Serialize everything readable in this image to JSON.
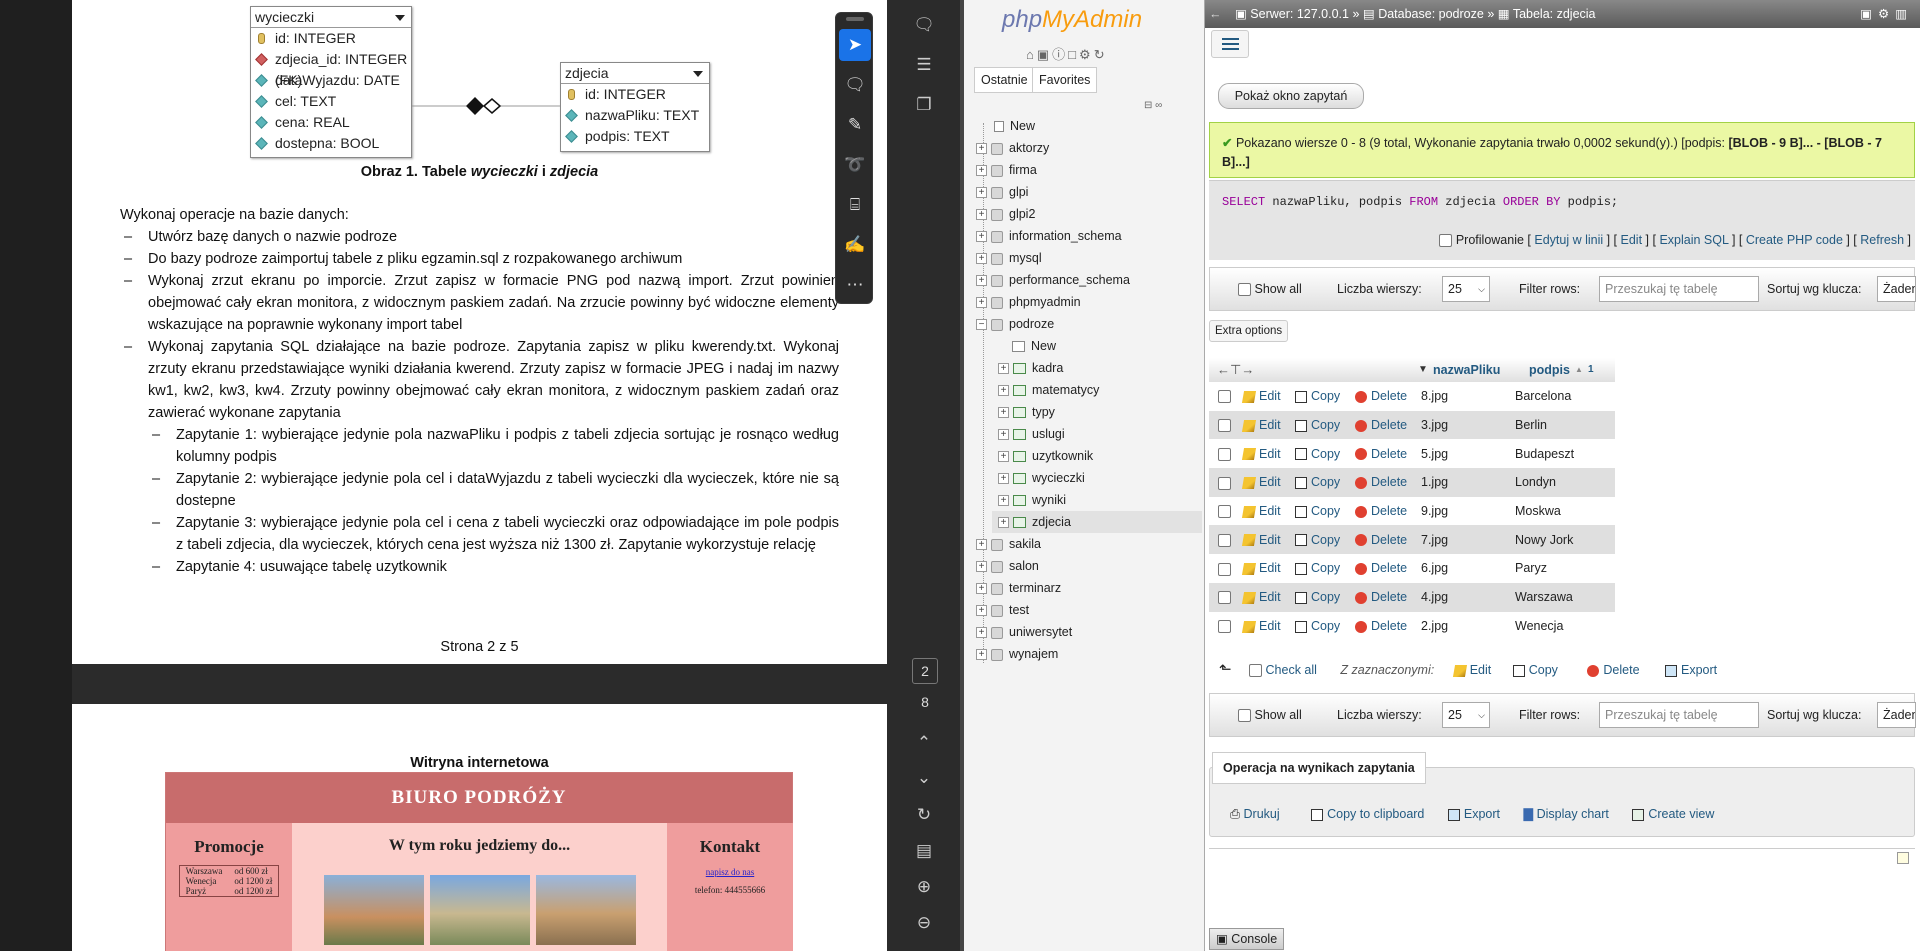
{
  "pdf": {
    "er": {
      "wycieczki": {
        "title": "wycieczki",
        "fields": [
          "id: INTEGER",
          "zdjecia_id: INTEGER (FK)",
          "dataWyjazdu: DATE",
          "cel: TEXT",
          "cena: REAL",
          "dostepna: BOOL"
        ]
      },
      "zdjecia": {
        "title": "zdjecia",
        "fields": [
          "id: INTEGER",
          "nazwaPliku: TEXT",
          "podpis: TEXT"
        ]
      }
    },
    "caption_prefix": "Obraz 1. Tabele ",
    "caption_t1": "wycieczki",
    "caption_mid": " i ",
    "caption_t2": "zdjecia",
    "intro": "Wykonaj operacje na bazie danych:",
    "items": [
      "Utwórz bazę danych o nazwie podroze",
      "Do bazy podroze zaimportuj tabele z pliku egzamin.sql z rozpakowanego archiwum",
      "Wykonaj zrzut ekranu po imporcie. Zrzut zapisz w formacie PNG pod nazwą import. Zrzut powinien obejmować cały ekran monitora, z widocznym paskiem zadań. Na zrzucie powinny być widoczne elementy wskazujące na poprawnie wykonany import tabel",
      "Wykonaj zapytania SQL działające na bazie podroze. Zapytania zapisz w pliku kwerendy.txt. Wykonaj zrzuty ekranu przedstawiające wyniki działania kwerend. Zrzuty zapisz w formacie JPEG i nadaj im nazwy kw1, kw2, kw3, kw4. Zrzuty powinny obejmować cały ekran monitora, z widocznym paskiem zadań oraz zawierać wykonane zapytania"
    ],
    "subitems": [
      "Zapytanie 1: wybierające jedynie pola nazwaPliku i podpis z tabeli zdjecia sortując je rosnąco według kolumny podpis",
      "Zapytanie 2: wybierające jedynie pola cel i dataWyjazdu z tabeli wycieczki dla wycieczek, które nie są dostepne",
      "Zapytanie 3: wybierające jedynie pola cel i cena z tabeli wycieczki oraz odpowiadające im pole podpis z tabeli zdjecia, dla wycieczek, których cena jest wyższa niż 1300 zł. Zapytanie wykorzystuje relację",
      "Zapytanie 4: usuwające tabelę uzytkownik"
    ],
    "page_footer": "Strona 2 z 5",
    "page2": {
      "heading": "Witryna internetowa",
      "site_title": "BIURO PODRÓŻY",
      "promo_title": "Promocje",
      "promo_rows": [
        [
          "Warszawa",
          "od 600 zł"
        ],
        [
          "Wenecja",
          "od 1200 zł"
        ],
        [
          "Paryż",
          "od 1200 zł"
        ]
      ],
      "center_title": "W tym roku jedziemy do...",
      "contact_title": "Kontakt",
      "contact_link": "napisz do nas",
      "contact_phone": "telefon: 444555666"
    },
    "page_indicator": "2",
    "page_total": "8"
  },
  "pma": {
    "logo_php": "php",
    "logo_my": "MyAdmin",
    "tabs": [
      "Ostatnie",
      "Favorites"
    ],
    "tree": {
      "new": "New",
      "dbs_before": [
        "aktorzy",
        "firma",
        "glpi",
        "glpi2",
        "information_schema",
        "mysql",
        "performance_schema",
        "phpmyadmin"
      ],
      "open_db": "podroze",
      "open_new": "New",
      "tables": [
        "kadra",
        "matematycy",
        "typy",
        "uslugi",
        "uzytkownik",
        "wycieczki",
        "wyniki",
        "zdjecia"
      ],
      "dbs_after": [
        "sakila",
        "salon",
        "terminarz",
        "test",
        "uniwersytet",
        "wynajem"
      ]
    },
    "breadcrumb": {
      "server": "Serwer: 127.0.0.1",
      "sep": "»",
      "database": "Database: podroze",
      "table": "Tabela: zdjecia"
    },
    "show_query_btn": "Pokaż okno zapytań",
    "success": "Pokazano wiersze 0 - 8 (9 total, Wykonanie zapytania trwało 0,0002 sekund(y).) [podpis: ",
    "success_bold": "[BLOB - 9 B]... - [BLOB - 7 B]...]",
    "sql": {
      "kw1": "SELECT",
      "rest1": " nazwaPliku, podpis ",
      "kw2": "FROM",
      "rest2": " zdjecia ",
      "kw3": "ORDER BY",
      "rest3": " podpis;"
    },
    "profiling": "Profilowanie",
    "sql_links": [
      "Edytuj w linii",
      "Edit",
      "Explain SQL",
      "Create PHP code",
      "Refresh"
    ],
    "controls": {
      "show_all": "Show all",
      "rows_label": "Liczba wierszy:",
      "rows_value": "25",
      "filter_label": "Filter rows:",
      "filter_placeholder": "Przeszukaj tę tabelę",
      "sort_label": "Sortuj wg klucza:",
      "sort_value": "Żaden"
    },
    "extra_options": "Extra options",
    "columns": {
      "c1": "nazwaPliku",
      "c2": "podpis",
      "sort_idx": "1"
    },
    "actions": {
      "edit": "Edit",
      "copy": "Copy",
      "delete": "Delete"
    },
    "rows": [
      [
        "8.jpg",
        "Barcelona"
      ],
      [
        "3.jpg",
        "Berlin"
      ],
      [
        "5.jpg",
        "Budapeszt"
      ],
      [
        "1.jpg",
        "Londyn"
      ],
      [
        "9.jpg",
        "Moskwa"
      ],
      [
        "7.jpg",
        "Nowy Jork"
      ],
      [
        "6.jpg",
        "Paryz"
      ],
      [
        "4.jpg",
        "Warszawa"
      ],
      [
        "2.jpg",
        "Wenecja"
      ]
    ],
    "bulk": {
      "check_all": "Check all",
      "with_selected": "Z zaznaczonymi:",
      "edit": "Edit",
      "copy": "Copy",
      "delete": "Delete",
      "export": "Export"
    },
    "ops_legend": "Operacja na wynikach zapytania",
    "ops": [
      "Drukuj",
      "Copy to clipboard",
      "Export",
      "Display chart",
      "Create view"
    ],
    "console": "Console"
  }
}
